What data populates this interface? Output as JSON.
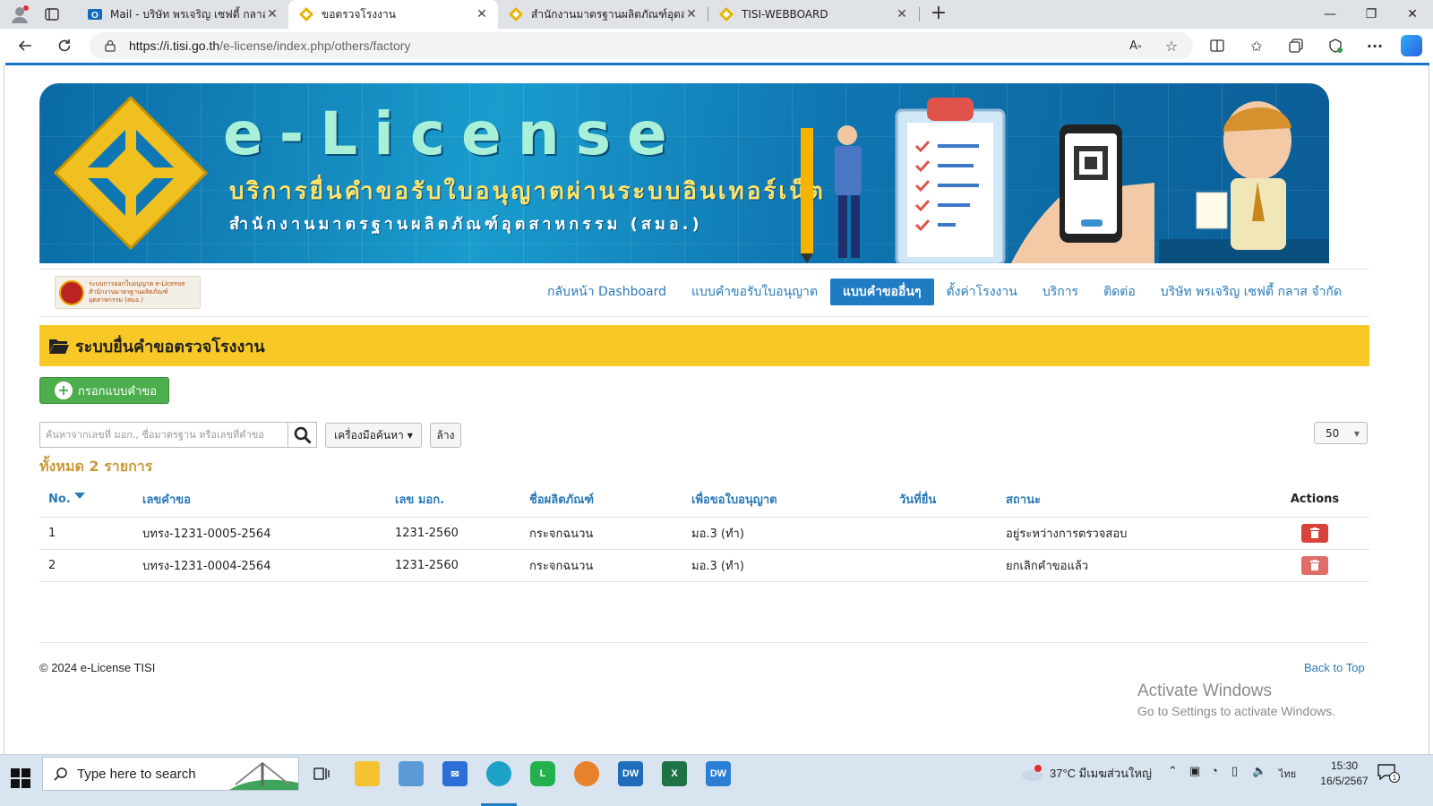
{
  "browser": {
    "tabs": [
      {
        "title": "Mail - บริษัท พรเจริญ เซฟตี้ กลาส จำกัด - Outlook",
        "icon": "outlook-icon"
      },
      {
        "title": "ขอตรวจโรงงาน",
        "icon": "tisi-icon"
      },
      {
        "title": "สำนักงานมาตรฐานผลิตภัณฑ์อุตสาหกรรม",
        "icon": "tisi-icon"
      },
      {
        "title": "TISI-WEBBOARD",
        "icon": "tisi-icon"
      }
    ],
    "url_domain": "https://i.tisi.go.th",
    "url_path": "/e-license/index.php/others/factory"
  },
  "banner": {
    "title": "e-License",
    "subtitle": "บริการยื่นคำขอรับใบอนุญาตผ่านระบบอินเทอร์เน็ต",
    "org": "สำนักงานมาตรฐานผลิตภัณฑ์อุตสาหกรรม (สมอ.)"
  },
  "logo": {
    "line1": "ระบบการออกใบอนุญาต e-License",
    "line2": "สำนักงานมาตรฐานผลิตภัณฑ์อุตสาหกรรม (สมอ.)"
  },
  "nav": {
    "items": [
      {
        "label": "กลับหน้า Dashboard",
        "active": false
      },
      {
        "label": "แบบคำขอรับใบอนุญาต",
        "active": false
      },
      {
        "label": "แบบคำขออื่นๆ",
        "active": true
      },
      {
        "label": "ตั้งค่าโรงงาน",
        "active": false
      },
      {
        "label": "บริการ",
        "active": false
      },
      {
        "label": "ติดต่อ",
        "active": false
      },
      {
        "label": "บริษัท พรเจริญ เซฟตี้ กลาส จำกัด",
        "active": false
      }
    ]
  },
  "page": {
    "title": "ระบบยื่นคำขอตรวจโรงงาน",
    "add_button": "กรอกแบบคำขอ",
    "search_placeholder": "ค้นหาจากเลขที่ มอก., ชื่อมาตรฐาน หรือเลขที่คำขอ",
    "tools_button": "เครื่องมือค้นหา",
    "clear_button": "ล้าง",
    "page_size": "50",
    "total": "ทั้งหมด 2 รายการ"
  },
  "table": {
    "headers": [
      "No.",
      "เลขคำขอ",
      "เลข มอก.",
      "ชื่อผลิตภัณฑ์",
      "เพื่อขอใบอนุญาต",
      "วันที่ยื่น",
      "สถานะ",
      "Actions"
    ],
    "rows": [
      {
        "no": "1",
        "request_no": "บทรง-1231-0005-2564",
        "tis_no": "1231-2560",
        "product": "กระจกฉนวน",
        "license": "มอ.3 (ทำ)",
        "date": "",
        "status": "อยู่ระหว่างการตรวจสอบ"
      },
      {
        "no": "2",
        "request_no": "บทรง-1231-0004-2564",
        "tis_no": "1231-2560",
        "product": "กระจกฉนวน",
        "license": "มอ.3 (ทำ)",
        "date": "",
        "status": "ยกเลิกคำขอแล้ว"
      }
    ]
  },
  "footer": {
    "copyright": "© 2024 e-License TISI",
    "back_to_top": "Back to Top"
  },
  "watermark": {
    "line1": "Activate Windows",
    "line2": "Go to Settings to activate Windows."
  },
  "taskbar": {
    "search_placeholder": "Type here to search",
    "weather": "37°C มีเมฆส่วนใหญ่",
    "language": "ไทย",
    "time": "15:30",
    "date": "16/5/2567",
    "notification_count": "1"
  },
  "colors": {
    "accent": "#1f7cc2",
    "title_bar": "#f8c926",
    "success": "#4cae4c",
    "danger": "#d9413b",
    "total_text": "#c79a3a"
  }
}
